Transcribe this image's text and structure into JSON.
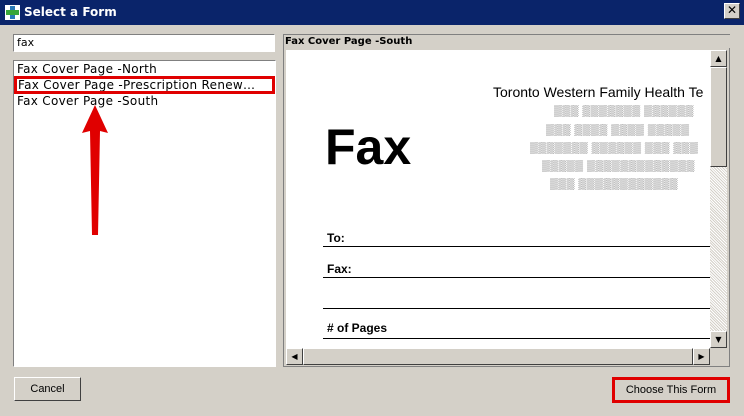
{
  "window": {
    "title": "Select a Form"
  },
  "search": {
    "value": "fax"
  },
  "forms": [
    {
      "label": "Fax Cover Page -North"
    },
    {
      "label": "Fax Cover Page -Prescription Renew…"
    },
    {
      "label": "Fax Cover Page -South"
    }
  ],
  "preview": {
    "title": "Fax Cover Page -South",
    "heading": "Fax",
    "clinic_name": "Toronto Western Family Health Te",
    "fields": {
      "to": "To:",
      "fax": "Fax:",
      "pages": "# of Pages"
    }
  },
  "buttons": {
    "cancel": "Cancel",
    "choose": "Choose This Form"
  },
  "colors": {
    "highlight": "#e00000",
    "titlebar": "#0a246a"
  }
}
